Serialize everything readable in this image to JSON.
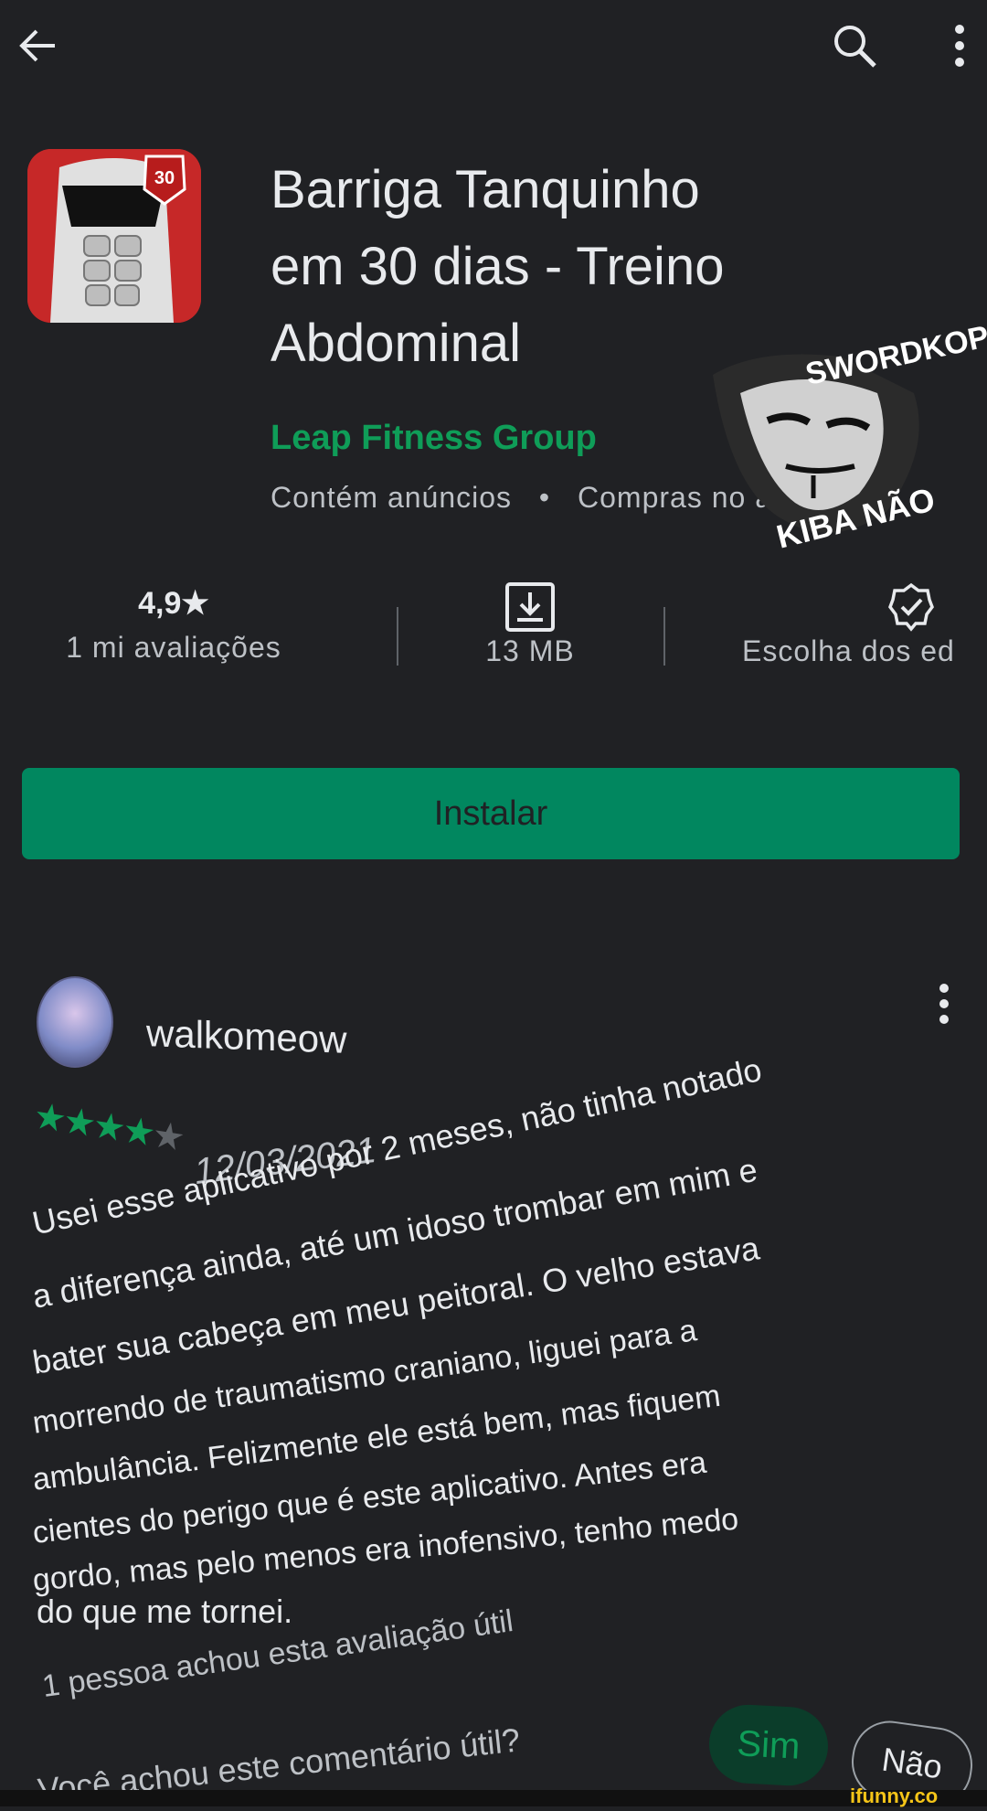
{
  "topbar": {
    "back_icon": "arrow-left-icon",
    "search_icon": "search-icon",
    "more_icon": "more-vertical-icon"
  },
  "app": {
    "title_lines": [
      "Barriga Tanquinho",
      "em 30 dias - Treino",
      "Abdominal"
    ],
    "developer": "Leap Fitness Group",
    "meta_ads": "Contém anúncios",
    "meta_separator": "•",
    "meta_purchases": "Compras no a",
    "icon_badge": "30"
  },
  "stats": {
    "rating": "4,9★",
    "rating_label": "1 mi avaliações",
    "size_icon": "download-box-icon",
    "size_label": "13 MB",
    "badge_icon": "editors-choice-icon",
    "badge_label": "Escolha dos ed"
  },
  "install_button": "Instalar",
  "review": {
    "author": "walkomeow",
    "rating_stars": 4,
    "date": "12/03/2021",
    "body_lines": [
      "Usei esse aplicativo por 2 meses, não tinha notado",
      "a diferença ainda, até um idoso trombar em mim e",
      "bater sua cabeça em meu peitoral. O velho estava",
      "morrendo de traumatismo craniano, liguei para a",
      "ambulância. Felizmente ele está bem, mas fiquem",
      "cientes do perigo que é este aplicativo. Antes era",
      "gordo, mas pelo menos era inofensivo, tenho medo",
      "do que me tornei."
    ],
    "helpful_count": "1 pessoa achou esta avaliação útil",
    "question": "Você achou este comentário útil?",
    "yes": "Sim",
    "no": "Não"
  },
  "watermarks": {
    "top": "SWORDKOP",
    "bottom": "KIBA NÃO",
    "site": "ifunny.co"
  },
  "colors": {
    "accent": "#01875f",
    "background": "#202124",
    "developer": "#0f9d58"
  }
}
